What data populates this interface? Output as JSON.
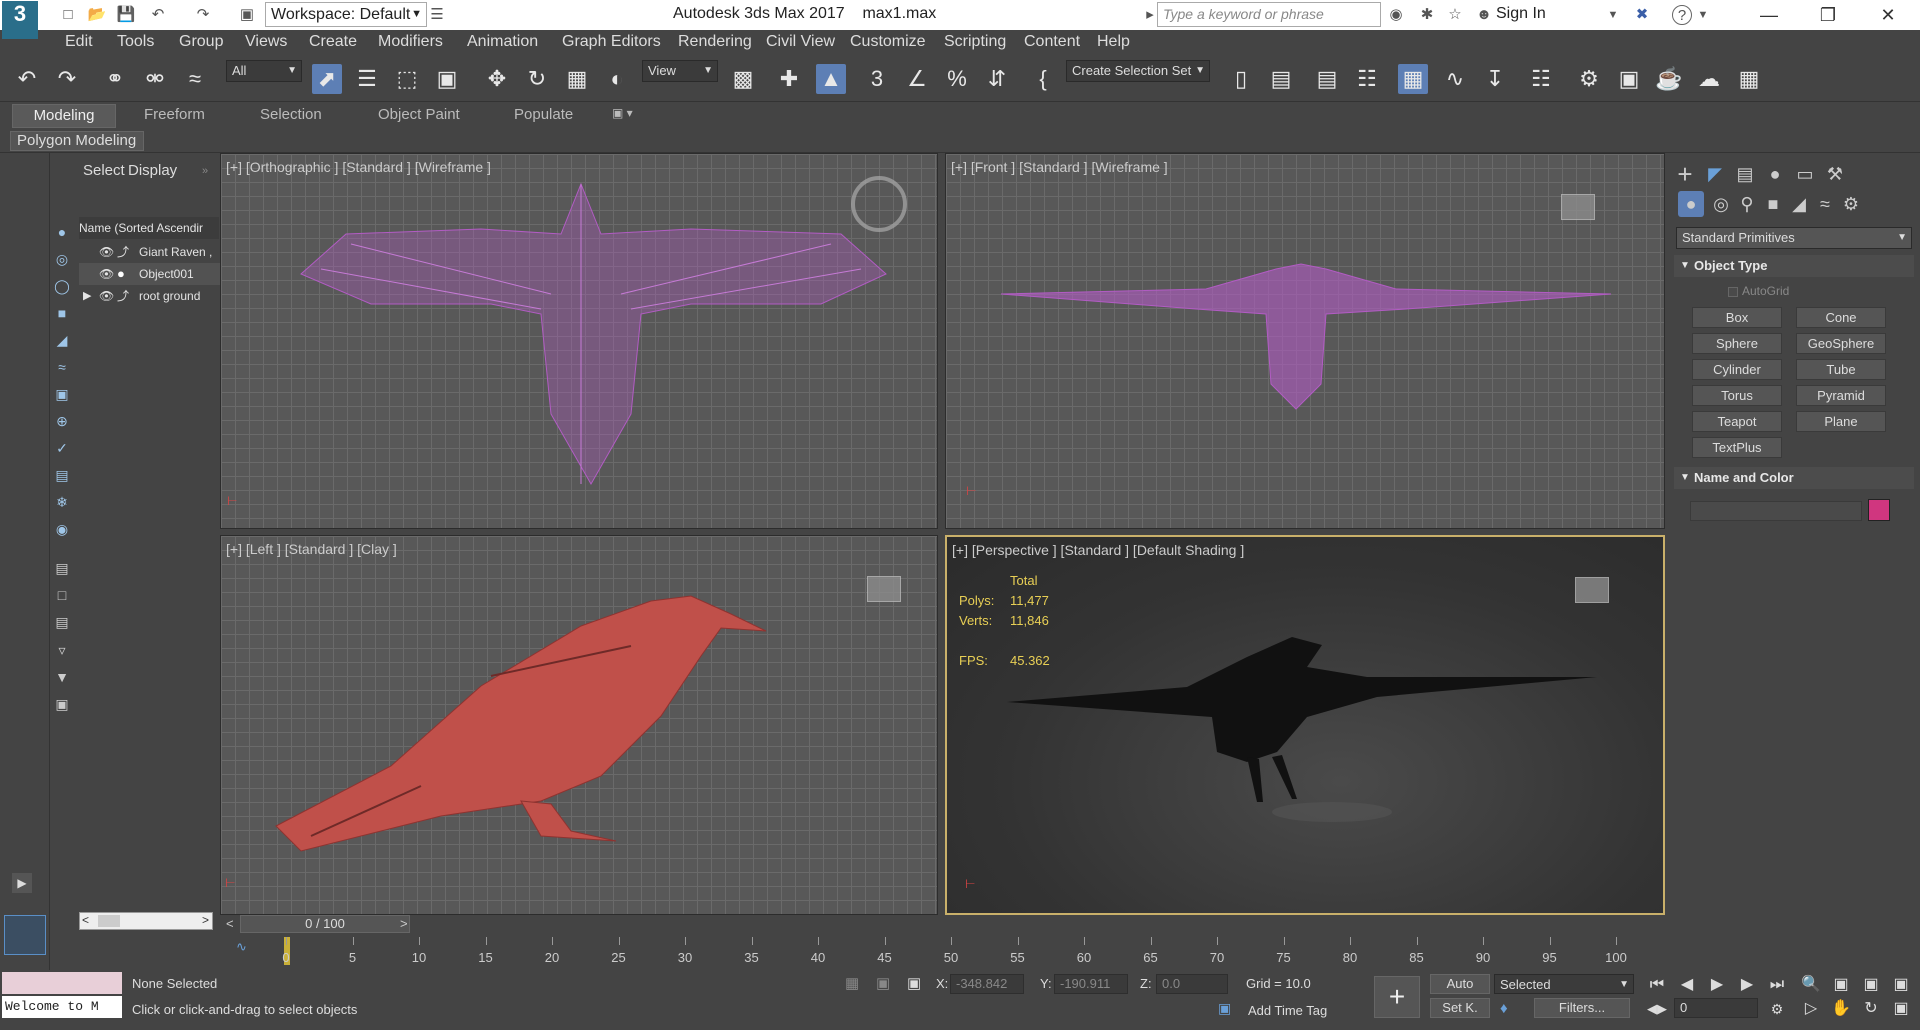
{
  "titlebar": {
    "app_title": "Autodesk 3ds Max 2017",
    "file_name": "max1.max",
    "workspace_label": "Workspace: Default",
    "search_placeholder": "Type a keyword or phrase",
    "sign_in_label": "Sign In",
    "logo_text": "3"
  },
  "menu": [
    "Edit",
    "Tools",
    "Group",
    "Views",
    "Create",
    "Modifiers",
    "Animation",
    "Graph Editors",
    "Rendering",
    "Civil View",
    "Customize",
    "Scripting",
    "Content",
    "Help"
  ],
  "toolbar": {
    "selection_filter": "All",
    "ref_coord": "View",
    "selection_set": "Create Selection Set"
  },
  "ribbon": {
    "tabs": [
      "Modeling",
      "Freeform",
      "Selection",
      "Object Paint",
      "Populate"
    ],
    "sub_label": "Polygon Modeling"
  },
  "explorer": {
    "tabs": [
      "Select",
      "Display"
    ],
    "header": "Name (Sorted Ascendir",
    "items": [
      {
        "label": "Giant Raven ,"
      },
      {
        "label": "Object001"
      },
      {
        "label": "root ground"
      }
    ]
  },
  "viewports": {
    "top_left": "[+] [Orthographic ] [Standard ] [Wireframe ]",
    "top_right": "[+] [Front ] [Standard ] [Wireframe ]",
    "bottom_left": "[+] [Left ] [Standard ] [Clay ]",
    "bottom_right": "[+] [Perspective ] [Standard ] [Default Shading ]",
    "stats": {
      "total_label": "Total",
      "polys_label": "Polys:",
      "polys_value": "11,477",
      "verts_label": "Verts:",
      "verts_value": "11,846",
      "fps_label": "FPS:",
      "fps_value": "45.362"
    },
    "wire_color": "#b25cc4",
    "clay_color": "#c0504a"
  },
  "command_panel": {
    "category": "Standard Primitives",
    "object_type_title": "Object Type",
    "autogrid_label": "AutoGrid",
    "primitives": [
      "Box",
      "Cone",
      "Sphere",
      "GeoSphere",
      "Cylinder",
      "Tube",
      "Torus",
      "Pyramid",
      "Teapot",
      "Plane",
      "TextPlus"
    ],
    "name_color_title": "Name and Color",
    "object_color": "#d0367f"
  },
  "timeline": {
    "frame_display": "0 / 100",
    "ticks": [
      "0",
      "5",
      "10",
      "15",
      "20",
      "25",
      "30",
      "35",
      "40",
      "45",
      "50",
      "55",
      "60",
      "65",
      "70",
      "75",
      "80",
      "85",
      "90",
      "95",
      "100"
    ]
  },
  "status": {
    "listener_text": "Welcome to M",
    "selection_text": "None Selected",
    "prompt_text": "Click or click-and-drag to select objects",
    "x_label": "X:",
    "x_value": "-348.842",
    "y_label": "Y:",
    "y_value": "-190.911",
    "z_label": "Z:",
    "z_value": "0.0",
    "grid_text": "Grid = 10.0",
    "add_time_tag": "Add Time Tag",
    "auto_label": "Auto",
    "setkey_label": "Set K.",
    "selected_dropdown": "Selected",
    "filters_label": "Filters...",
    "frame_value": "0"
  }
}
